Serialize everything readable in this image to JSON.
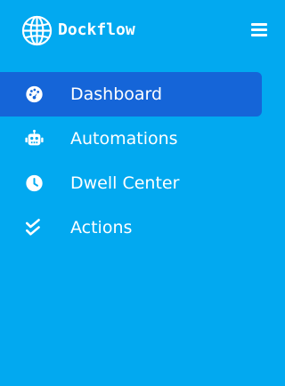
{
  "brand": {
    "name": "Dockflow",
    "logo_icon": "globe-icon"
  },
  "header": {
    "menu_icon": "hamburger-menu-icon"
  },
  "nav": {
    "active_index": 0,
    "items": [
      {
        "label": "Dashboard",
        "icon": "speedometer-icon",
        "active": true
      },
      {
        "label": "Automations",
        "icon": "robot-icon",
        "active": false
      },
      {
        "label": "Dwell Center",
        "icon": "clock-icon",
        "active": false
      },
      {
        "label": "Actions",
        "icon": "double-check-icon",
        "active": false
      }
    ]
  },
  "colors": {
    "sidebar_background": "#02a9f0",
    "active_item_background": "#1565d8",
    "text": "#ffffff"
  }
}
